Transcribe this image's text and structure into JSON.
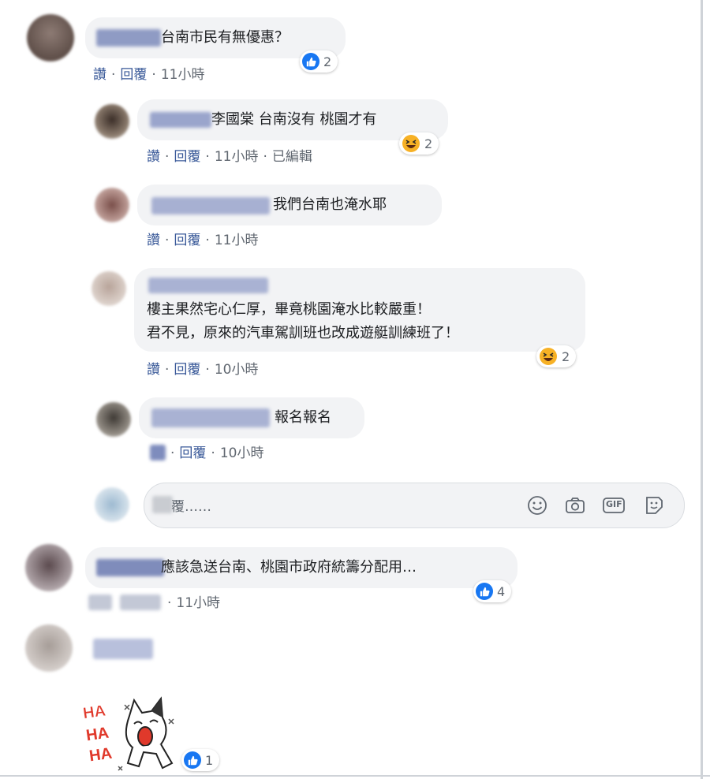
{
  "comments": [
    {
      "text": "台南市民有無優惠？",
      "actions": {
        "like": "讚",
        "reply": "回覆",
        "time": "11小時"
      },
      "reaction_count": "2"
    },
    {
      "text": "李國棠 台南沒有 桃園才有",
      "actions": {
        "like": "讚",
        "reply": "回覆",
        "time": "11小時",
        "edited": "已編輯"
      },
      "reaction_count": "2"
    },
    {
      "text": "我們台南也淹水耶",
      "actions": {
        "like": "讚",
        "reply": "回覆",
        "time": "11小時"
      }
    },
    {
      "text_line1": "樓主果然宅心仁厚，畢竟桃園淹水比較嚴重！",
      "text_line2": "君不見，原來的汽車駕訓班也改成遊艇訓練班了！",
      "actions": {
        "like": "讚",
        "reply": "回覆",
        "time": "10小時"
      },
      "reaction_count": "2"
    },
    {
      "text": "報名報名",
      "actions": {
        "reply": "回覆",
        "time": "10小時"
      }
    },
    {
      "text": "應該急送台南、桃園市政府統籌分配用…",
      "actions": {
        "time": "11小時"
      },
      "reaction_count": "4"
    },
    {
      "sticker_text": "HA HA HA",
      "reaction_count": "1"
    }
  ],
  "reply_box": {
    "placeholder": "覆……",
    "icons": [
      "emoji-icon",
      "camera-icon",
      "gif-icon",
      "sticker-icon"
    ],
    "gif_label": "GIF"
  },
  "colors": {
    "bubble": "#f2f3f5",
    "link": "#385898",
    "like_blue": "#1877f2",
    "haha_yellow": "#f7b125"
  }
}
